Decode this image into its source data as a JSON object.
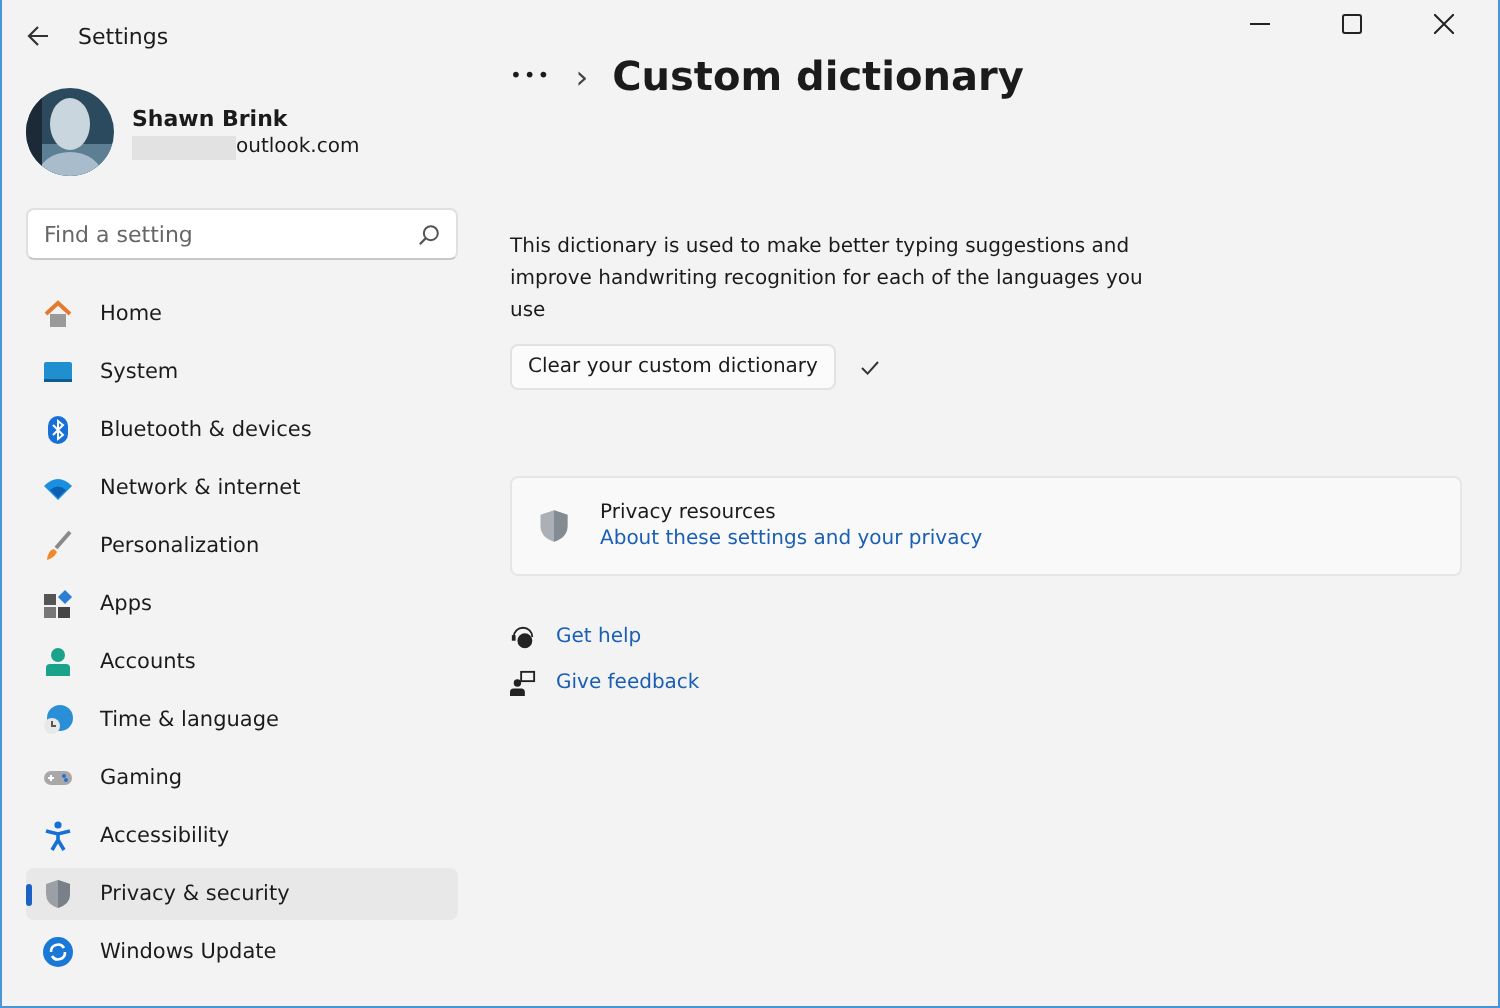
{
  "window": {
    "title": "Settings"
  },
  "account": {
    "name": "Shawn Brink",
    "email": "outlook.com"
  },
  "search": {
    "placeholder": "Find a setting"
  },
  "nav": [
    {
      "label": "Home",
      "selected": false,
      "kind": "home"
    },
    {
      "label": "System",
      "selected": false,
      "kind": "system"
    },
    {
      "label": "Bluetooth & devices",
      "selected": false,
      "kind": "bluetooth"
    },
    {
      "label": "Network & internet",
      "selected": false,
      "kind": "wifi"
    },
    {
      "label": "Personalization",
      "selected": false,
      "kind": "brush"
    },
    {
      "label": "Apps",
      "selected": false,
      "kind": "apps"
    },
    {
      "label": "Accounts",
      "selected": false,
      "kind": "person"
    },
    {
      "label": "Time & language",
      "selected": false,
      "kind": "globe"
    },
    {
      "label": "Gaming",
      "selected": false,
      "kind": "gamepad"
    },
    {
      "label": "Accessibility",
      "selected": false,
      "kind": "accessibility"
    },
    {
      "label": "Privacy & security",
      "selected": true,
      "kind": "shield"
    },
    {
      "label": "Windows Update",
      "selected": false,
      "kind": "update"
    }
  ],
  "breadcrumb": {
    "more": "•••",
    "separator": "›",
    "title": "Custom dictionary"
  },
  "description": "This dictionary is used to make better typing suggestions and improve handwriting recognition for each of the languages you use",
  "clear_button": {
    "label": "Clear your custom dictionary",
    "done": true
  },
  "privacy_card": {
    "title": "Privacy resources",
    "link": "About these settings and your privacy"
  },
  "help_links": [
    {
      "label": "Get help",
      "kind": "help"
    },
    {
      "label": "Give feedback",
      "kind": "feedback"
    }
  ]
}
